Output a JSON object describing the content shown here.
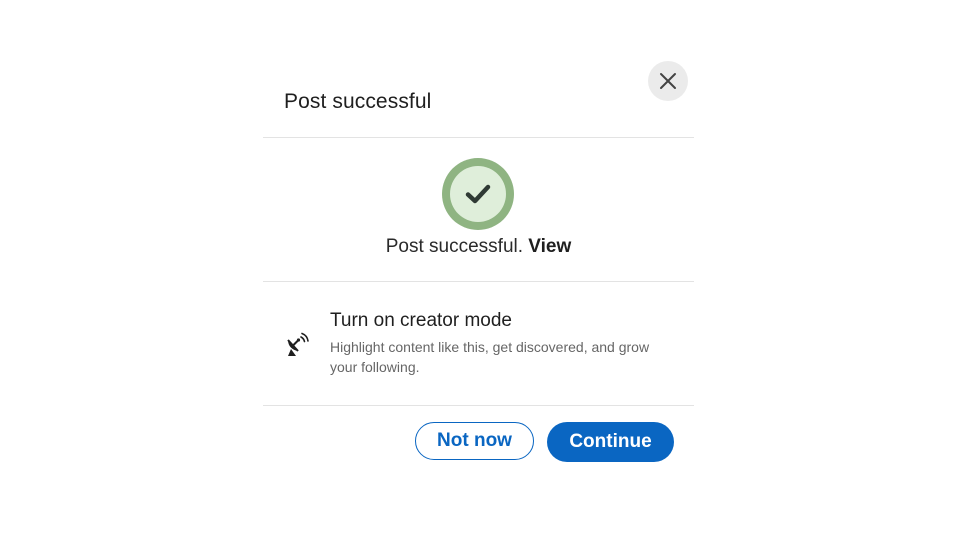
{
  "modal": {
    "title": "Post successful",
    "close_icon": "close-icon"
  },
  "success": {
    "icon": "checkmark-circle-icon",
    "message": "Post successful.",
    "view_link": "View",
    "colors": {
      "outer_ring": "#8fb482",
      "inner_fill": "#dfeeda",
      "check": "#2f3a34"
    }
  },
  "creator_mode": {
    "icon": "satellite-dish-icon",
    "title": "Turn on creator mode",
    "description": "Highlight content like this, get discovered, and grow your following."
  },
  "footer": {
    "secondary_label": "Not now",
    "primary_label": "Continue"
  },
  "colors": {
    "accent": "#0a66c2",
    "divider": "#e3e3e3",
    "close_bg": "#ebebeb"
  }
}
